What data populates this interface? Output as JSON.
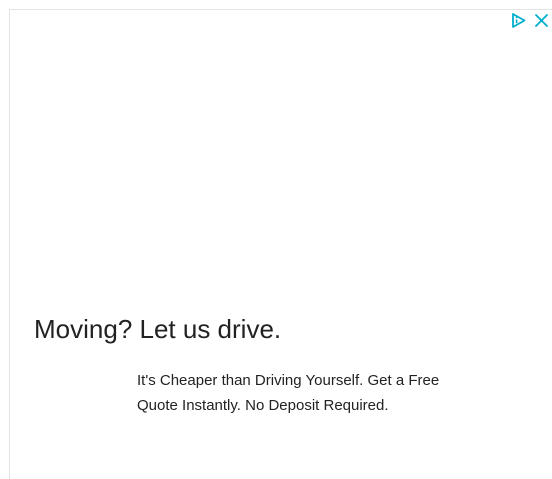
{
  "ad": {
    "headline": "Moving? Let us drive.",
    "body": "It's Cheaper than Driving Yourself. Get a Free Quote Instantly. No Deposit Required.",
    "controls": {
      "adchoices_icon": "adchoices-icon",
      "close_icon": "close-icon",
      "accent_color": "#00aecd"
    }
  }
}
